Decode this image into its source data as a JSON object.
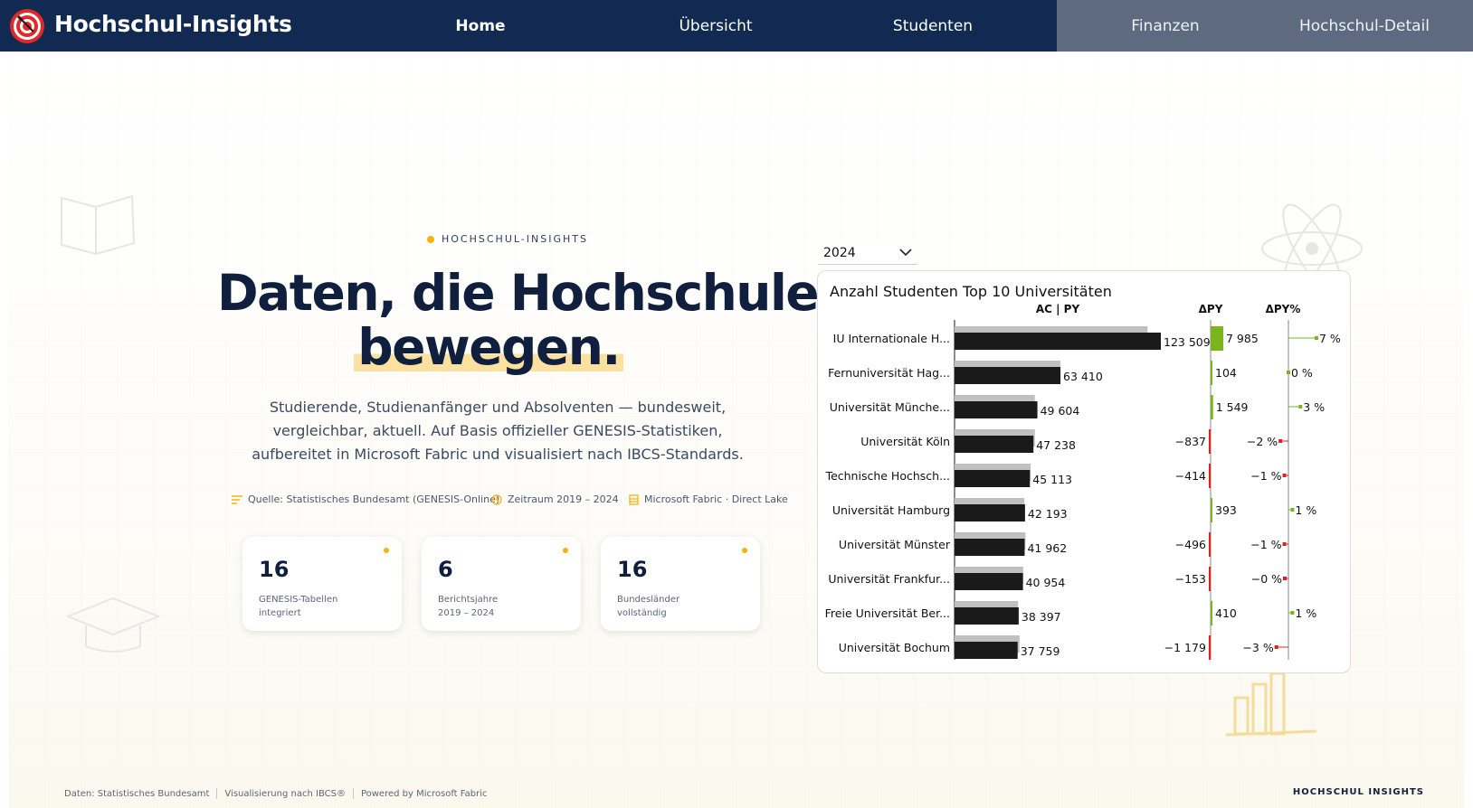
{
  "nav": {
    "brand": "Hochschul-Insights",
    "tabs": [
      {
        "label": "Home"
      },
      {
        "label": "Übersicht"
      },
      {
        "label": "Studenten"
      },
      {
        "label": "Finanzen"
      },
      {
        "label": "Hochschul-Detail"
      }
    ]
  },
  "hero": {
    "eyebrow": "HOCHSCHUL-INSIGHTS",
    "title_line1": "Daten, die Hochschulen",
    "title_line2": "bewegen.",
    "lead": "Studierende, Studienanfänger und Absolventen — bundesweit, vergleichbar, aktuell. Auf Basis offizieller GENESIS-Statistiken, aufbereitet in Microsoft Fabric und visualisiert nach IBCS-Standards.",
    "meta": [
      {
        "icon": "list-icon",
        "text": "Quelle: Statistisches Bundesamt (GENESIS-Online)"
      },
      {
        "icon": "clock-icon",
        "text": "Zeitraum 2019 – 2024"
      },
      {
        "icon": "database-icon",
        "text": "Microsoft Fabric · Direct Lake"
      }
    ],
    "kpis": [
      {
        "value": "16",
        "label_line1": "GENESIS-Tabellen",
        "label_line2": "integriert"
      },
      {
        "value": "6",
        "label_line1": "Berichtsjahre",
        "label_line2": "2019 – 2024"
      },
      {
        "value": "16",
        "label_line1": "Bundesländer",
        "label_line2": "vollständig"
      }
    ]
  },
  "slicer": {
    "selected": "2024"
  },
  "chart_data": {
    "type": "bar",
    "title": "Anzahl Studenten Top 10 Universitäten",
    "headers": {
      "main": "AC | PY",
      "delta": "ΔPY",
      "delta_pct": "ΔPY%"
    },
    "categories": [
      "IU Internationale H...",
      "Fernuniversität Hag...",
      "Universität Münche...",
      "Universität Köln",
      "Technische Hochsch...",
      "Universität Hamburg",
      "Universität Münster",
      "Universität Frankfur...",
      "Freie Universität Ber...",
      "Universität Bochum"
    ],
    "series": [
      {
        "name": "AC",
        "values": [
          123509,
          63410,
          49604,
          47238,
          45113,
          42193,
          41962,
          40954,
          38397,
          37759
        ]
      },
      {
        "name": "PY",
        "values": [
          115524,
          63306,
          48055,
          48075,
          45527,
          41800,
          42458,
          41107,
          37987,
          38938
        ]
      }
    ],
    "value_labels": [
      "123 509",
      "63 410",
      "49 604",
      "47 238",
      "45 113",
      "42 193",
      "41 962",
      "40 954",
      "38 397",
      "37 759"
    ],
    "delta": [
      7985,
      104,
      1549,
      -837,
      -414,
      393,
      -496,
      -153,
      410,
      -1179
    ],
    "delta_labels": [
      "7 985",
      "104",
      "1 549",
      "−837",
      "−414",
      "393",
      "−496",
      "−153",
      "410",
      "−1 179"
    ],
    "delta_pct": [
      7,
      0,
      3,
      -2,
      -1,
      1,
      -1,
      -0.4,
      1,
      -3
    ],
    "delta_pct_labels": [
      "7 %",
      "0 %",
      "3 %",
      "−2 %",
      "−1 %",
      "1 %",
      "−1 %",
      "−0 %",
      "1 %",
      "−3 %"
    ],
    "colors": {
      "ac": "#1a1a1a",
      "py": "#c0c0c0",
      "positive": "#7ab51d",
      "negative": "#e02020"
    }
  },
  "footer": {
    "items": [
      "Daten: Statistisches Bundesamt",
      "Visualisierung nach IBCS®",
      "Powered by Microsoft Fabric"
    ],
    "right": "HOCHSCHUL INSIGHTS"
  }
}
